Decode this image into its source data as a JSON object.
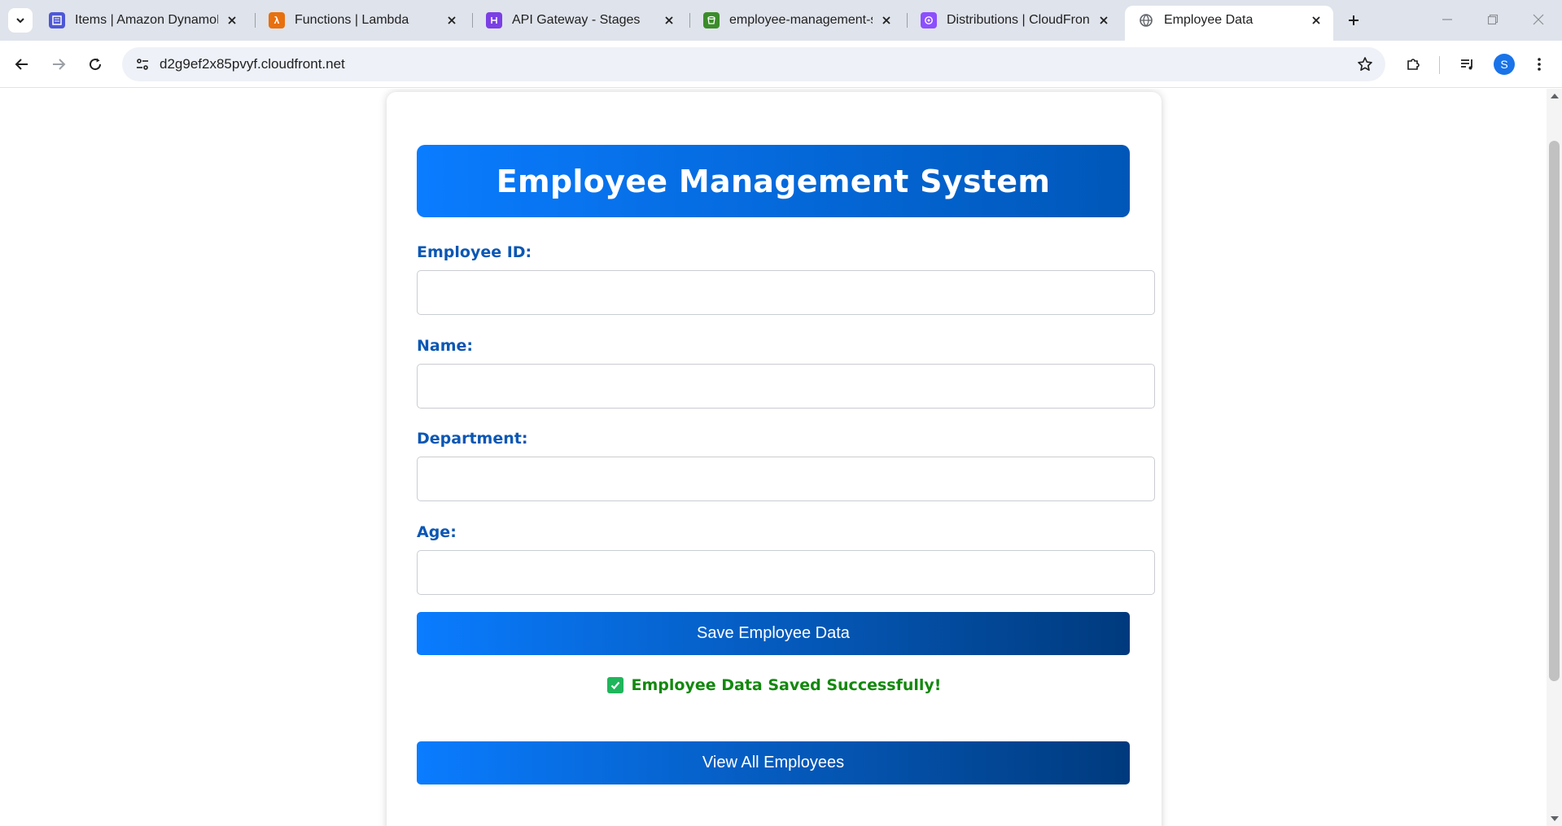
{
  "browser": {
    "tabs": [
      {
        "title": "Items | Amazon DynamoDB",
        "icon": "dynamodb-icon",
        "color": "#4d57d6"
      },
      {
        "title": "Functions | Lambda",
        "icon": "lambda-icon",
        "color": "#e8700d"
      },
      {
        "title": "API Gateway - Stages",
        "icon": "api-gateway-icon",
        "color": "#7b3fe4"
      },
      {
        "title": "employee-management-sys",
        "icon": "s3-bucket-icon",
        "color": "#3b8c2a"
      },
      {
        "title": "Distributions | CloudFront",
        "icon": "cloudfront-icon",
        "color": "#8c4fff"
      },
      {
        "title": "Employee Data",
        "icon": "globe-icon",
        "color": "#5f6368"
      }
    ],
    "active_tab": 5,
    "url": "d2g9ef2x85pvyf.cloudfront.net",
    "profile_initial": "S"
  },
  "app": {
    "title": "Employee Management System",
    "fields": [
      {
        "label": "Employee ID:",
        "value": "",
        "placeholder": ""
      },
      {
        "label": "Name:",
        "value": "",
        "placeholder": ""
      },
      {
        "label": "Department:",
        "value": "",
        "placeholder": ""
      },
      {
        "label": "Age:",
        "value": "",
        "placeholder": ""
      }
    ],
    "save_button": "Save Employee Data",
    "status_message": "Employee Data Saved Successfully!",
    "view_button": "View All Employees"
  },
  "colors": {
    "accent": "#0a7cff",
    "accent_dark": "#003a7d",
    "label": "#0b57b4",
    "success": "#13880e"
  }
}
